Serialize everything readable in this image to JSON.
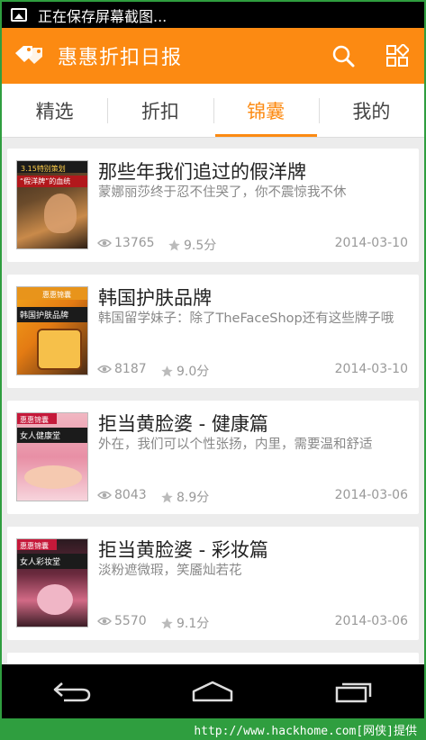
{
  "status_bar": {
    "notification_text": "正在保存屏幕截图..."
  },
  "app_bar": {
    "title": "惠惠折扣日报"
  },
  "tabs": [
    {
      "label": "精选",
      "active": false
    },
    {
      "label": "折扣",
      "active": false
    },
    {
      "label": "锦囊",
      "active": true
    },
    {
      "label": "我的",
      "active": false
    }
  ],
  "articles": [
    {
      "title": "那些年我们追过的假洋牌",
      "subtitle": "蒙娜丽莎终于忍不住哭了，你不震惊我不休",
      "views": "13765",
      "rating": "9.5分",
      "date": "2014-03-10",
      "thumb_text": [
        "3.15特别策划",
        "“假洋牌”的血统"
      ]
    },
    {
      "title": "韩国护肤品牌",
      "subtitle": "韩国留学妹子：除了TheFaceShop还有这些牌子哦",
      "views": "8187",
      "rating": "9.0分",
      "date": "2014-03-10",
      "thumb_text": [
        "惠惠锦囊",
        "韩国护肤品牌"
      ]
    },
    {
      "title": "拒当黄脸婆 - 健康篇",
      "subtitle": "外在，我们可以个性张扬，内里，需要温和舒适",
      "views": "8043",
      "rating": "8.9分",
      "date": "2014-03-06",
      "thumb_text": [
        "惠惠锦囊",
        "女人健康堂"
      ]
    },
    {
      "title": "拒当黄脸婆 - 彩妆篇",
      "subtitle": "淡粉遮微瑕，笑靥灿若花",
      "views": "5570",
      "rating": "9.1分",
      "date": "2014-03-06",
      "thumb_text": [
        "惠惠锦囊",
        "女人彩妆堂"
      ]
    }
  ],
  "footer": {
    "watermark": "http://www.hackhome.com[网侠]提供"
  },
  "colors": {
    "accent": "#fc8a12",
    "watermark_green": "#2f9e3f"
  },
  "icons": [
    "gallery-icon",
    "logo-tags-icon",
    "search-icon",
    "grid-icon",
    "eye-icon",
    "star-icon",
    "back-icon",
    "home-icon",
    "recents-icon"
  ]
}
